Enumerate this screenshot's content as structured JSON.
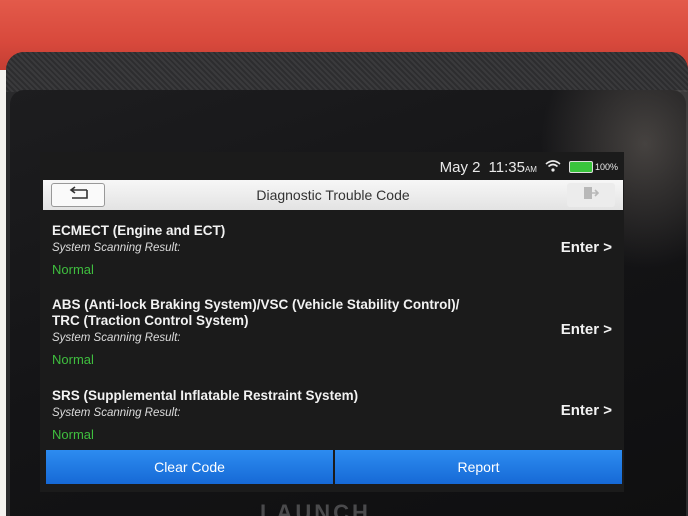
{
  "status_bar": {
    "date": "May 2",
    "time": "11:35",
    "time_suffix": "AM",
    "battery": "100%",
    "battery_color": "#39c43c"
  },
  "header": {
    "title": "Diagnostic Trouble Code",
    "back_icon": "back-arrow-icon",
    "exit_icon": "exit-icon"
  },
  "systems": [
    {
      "name_lines": [
        "ECMECT (Engine and ECT)"
      ],
      "label": "System Scanning Result:",
      "result": "Normal",
      "action": "Enter >"
    },
    {
      "name_lines": [
        "ABS (Anti-lock Braking System)/VSC (Vehicle Stability Control)/",
        "TRC (Traction Control System)"
      ],
      "label": "System Scanning Result:",
      "result": "Normal",
      "action": "Enter >"
    },
    {
      "name_lines": [
        "SRS (Supplemental Inflatable Restraint System)"
      ],
      "label": "System Scanning Result:",
      "result": "Normal",
      "action": "Enter >"
    }
  ],
  "footer": {
    "clear_code": "Clear Code",
    "report": "Report"
  },
  "brand": "LAUNCH",
  "colors": {
    "accent": "#1e78e6",
    "normal": "#3fbf3f",
    "device_red": "#d8493c"
  }
}
